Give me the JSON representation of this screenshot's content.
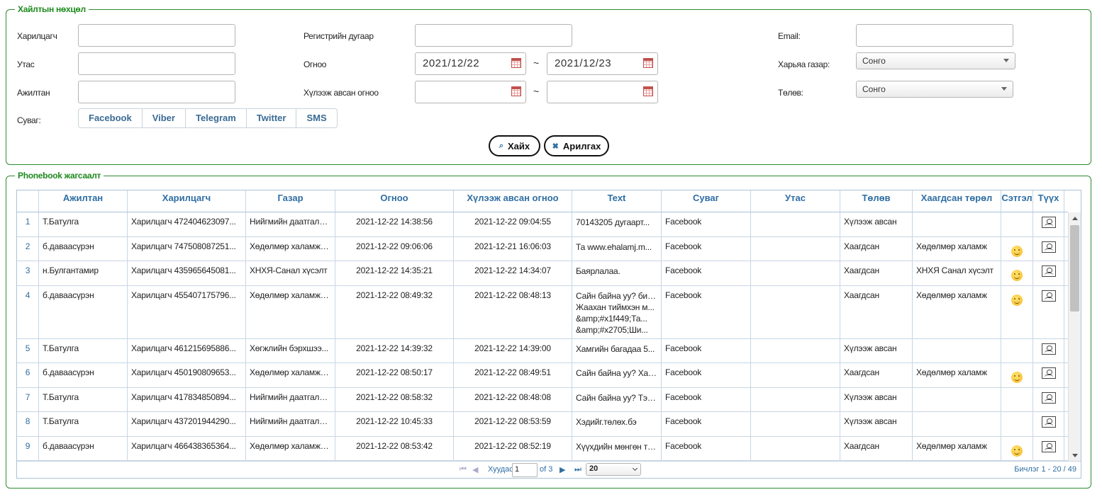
{
  "search": {
    "legend": "Хайлтын нөхцөл",
    "labels": {
      "customer": "Харилцагч",
      "phone": "Утас",
      "employee": "Ажилтан",
      "channel": "Суваг:",
      "register": "Регистрийн дугаар",
      "date": "Огноо",
      "received_date": "Хүлээж авсан огноо",
      "email": "Email:",
      "jurisdiction": "Харьяа газар:",
      "status": "Төлөв:"
    },
    "date_from": "2021/12/22",
    "date_to": "2021/12/23",
    "received_from": "",
    "received_to": "",
    "tilde": "~",
    "jurisdiction_value": "Сонго",
    "status_value": "Сонго",
    "channels": [
      "Facebook",
      "Viber",
      "Telegram",
      "Twitter",
      "SMS"
    ],
    "search_button": "Хайх",
    "clear_button": "Арилгах"
  },
  "results": {
    "legend": "Phonebook жагсаалт",
    "columns": [
      "",
      "Ажилтан",
      "Харилцагч",
      "Газар",
      "Огноо",
      "Хүлээж авсан огноо",
      "Text",
      "Суваг",
      "Утас",
      "Төлөв",
      "Хаагдсан төрөл",
      "Сэтгэл",
      "Түүх"
    ],
    "rows": [
      {
        "n": "1",
        "employee": "Т.Батулга",
        "customer": "Харилцагч 472404623097...",
        "place": "Нийгмийн даатгалы...",
        "date": "2021-12-22 14:38:56",
        "received": "2021-12-22 09:04:55",
        "text": [
          "70143205 дугаарт..."
        ],
        "channel": "Facebook",
        "phone": "",
        "status": "Хүлээж авсан",
        "closed_type": "",
        "mood": false
      },
      {
        "n": "2",
        "employee": "б.даваасүрэн",
        "customer": "Харилцагч 747508087251...",
        "place": "Хөдөлмөр халамжи...",
        "date": "2021-12-22 09:06:06",
        "received": "2021-12-21 16:06:03",
        "text": [
          "Та www.ehalamj.m..."
        ],
        "channel": "Facebook",
        "phone": "",
        "status": "Хаагдсан",
        "closed_type": "Хөдөлмөр халамж",
        "mood": true
      },
      {
        "n": "3",
        "employee": "н.Булгантамир",
        "customer": "Харилцагч 435965645081...",
        "place": "ХНХЯ-Санал хүсэлт",
        "date": "2021-12-22 14:35:21",
        "received": "2021-12-22 14:34:07",
        "text": [
          "Баярлалаа."
        ],
        "channel": "Facebook",
        "phone": "",
        "status": "Хаагдсан",
        "closed_type": "ХНХЯ Санал хүсэлт",
        "mood": true
      },
      {
        "n": "4",
        "employee": "б.даваасүрэн",
        "customer": "Харилцагч 455407175796...",
        "place": "Хөдөлмөр халамжи...",
        "date": "2021-12-22 08:49:32",
        "received": "2021-12-22 08:48:13",
        "text": [
          "Сайн байна уу? бид...",
          "Жаахан тиймхэн м...",
          "&amp;#x1f449;Та...",
          "&amp;#x2705;Ши..."
        ],
        "channel": "Facebook",
        "phone": "",
        "status": "Хаагдсан",
        "closed_type": "Хөдөлмөр халамж",
        "mood": true
      },
      {
        "n": "5",
        "employee": "Т.Батулга",
        "customer": "Харилцагч 461215695886...",
        "place": "Хөгжлийн бэрхшээ...",
        "date": "2021-12-22 14:39:32",
        "received": "2021-12-22 14:39:00",
        "text": [
          "Хамгийн багадаа 5..."
        ],
        "channel": "Facebook",
        "phone": "",
        "status": "Хүлээж авсан",
        "closed_type": "",
        "mood": false
      },
      {
        "n": "6",
        "employee": "б.даваасүрэн",
        "customer": "Харилцагч 450190809653...",
        "place": "Хөдөлмөр халамжи...",
        "date": "2021-12-22 08:50:17",
        "received": "2021-12-22 08:49:51",
        "text": [
          "Сайн байна уу? Хал..."
        ],
        "channel": "Facebook",
        "phone": "",
        "status": "Хаагдсан",
        "closed_type": "Хөдөлмөр халамж",
        "mood": true
      },
      {
        "n": "7",
        "employee": "Т.Батулга",
        "customer": "Харилцагч 417834850894...",
        "place": "Нийгмийн даатгалы...",
        "date": "2021-12-22 08:58:32",
        "received": "2021-12-22 08:48:08",
        "text": [
          "Сайн байна уу? Тэр..."
        ],
        "channel": "Facebook",
        "phone": "",
        "status": "Хүлээж авсан",
        "closed_type": "",
        "mood": false
      },
      {
        "n": "8",
        "employee": "Т.Батулга",
        "customer": "Харилцагч 437201944290...",
        "place": "Нийгмийн даатгалы...",
        "date": "2021-12-22 10:45:33",
        "received": "2021-12-22 08:53:59",
        "text": [
          "Хэдийг.төлөх.бэ"
        ],
        "channel": "Facebook",
        "phone": "",
        "status": "Хүлээж авсан",
        "closed_type": "",
        "mood": false
      },
      {
        "n": "9",
        "employee": "б.даваасүрэн",
        "customer": "Харилцагч 466438365364...",
        "place": "Хөдөлмөр халамжи...",
        "date": "2021-12-22 08:53:42",
        "received": "2021-12-22 08:52:19",
        "text": [
          "Хүүхдийн мөнгөн тэ..."
        ],
        "channel": "Facebook",
        "phone": "",
        "status": "Хаагдсан",
        "closed_type": "Хөдөлмөр халамж",
        "mood": true
      }
    ],
    "pager": {
      "page_label": "Хуудас",
      "page_value": "1",
      "of_label": "of 3",
      "page_size": "20",
      "summary": "Бичлэг 1 - 20 / 49"
    }
  }
}
